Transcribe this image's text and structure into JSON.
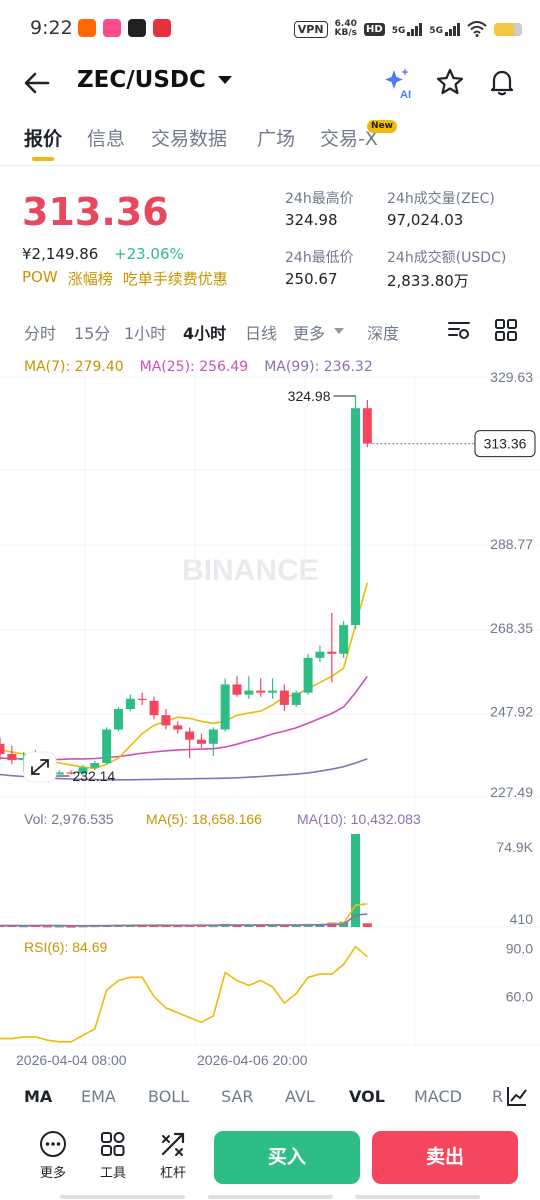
{
  "status": {
    "time": "9:22",
    "vpn": "VPN",
    "speed_value": "6.40",
    "speed_unit": "KB/s",
    "hd_label": "HD",
    "net1": "5G",
    "net2": "5G"
  },
  "header": {
    "title": "ZEC/USDC",
    "ai_label": "AI"
  },
  "tabs": [
    {
      "label": "报价"
    },
    {
      "label": "信息"
    },
    {
      "label": "交易数据"
    },
    {
      "label": "广场"
    },
    {
      "label": "交易-X"
    }
  ],
  "tab_badge": "New",
  "price": {
    "last": "313.36",
    "cny": "¥2,149.86",
    "change": "+23.06%",
    "tags": [
      "POW",
      "涨幅榜",
      "吃单手续费优惠"
    ]
  },
  "stats": {
    "high_label": "24h最高价",
    "high_value": "324.98",
    "low_label": "24h最低价",
    "low_value": "250.67",
    "vol_label": "24h成交量(ZEC)",
    "vol_value": "97,024.03",
    "amount_label": "24h成交额(USDC)",
    "amount_value": "2,833.80万"
  },
  "intervals": [
    "分时",
    "15分",
    "1小时",
    "4小时",
    "日线",
    "更多",
    "深度"
  ],
  "ma_legend": {
    "ma7": "MA(7): 279.40",
    "ma25": "MA(25): 256.49",
    "ma99": "MA(99): 236.32"
  },
  "colors": {
    "up": "#2ebd85",
    "down": "#f6465d",
    "ma7": "#f0b90b",
    "ma25": "#d04fba",
    "ma99": "#8b6fb8",
    "accent": "#f0b90b"
  },
  "watermark": "BINANCE",
  "chart_data": {
    "type": "candlestick",
    "price_axis_ticks": [
      "329.63",
      "288.77",
      "268.35",
      "247.92",
      "227.49"
    ],
    "ylim": [
      227.49,
      329.63
    ],
    "last_price_label": "313.36",
    "high_marker": "324.98",
    "low_marker": "232.14",
    "x_labels": [
      "2026-04-04 08:00",
      "2026-04-06 20:00"
    ],
    "candles": [
      {
        "o": 240.0,
        "h": 241.5,
        "l": 236.0,
        "c": 237.5
      },
      {
        "o": 237.5,
        "h": 239.5,
        "l": 235.0,
        "c": 236.0
      },
      {
        "o": 236.0,
        "h": 238.0,
        "l": 233.0,
        "c": 236.5
      },
      {
        "o": 236.5,
        "h": 238.5,
        "l": 232.5,
        "c": 233.0
      },
      {
        "o": 233.0,
        "h": 234.0,
        "l": 232.14,
        "c": 232.8
      },
      {
        "o": 232.5,
        "h": 233.5,
        "l": 232.5,
        "c": 233.0
      },
      {
        "o": 233.0,
        "h": 233.5,
        "l": 232.5,
        "c": 232.8
      },
      {
        "o": 232.8,
        "h": 234.8,
        "l": 232.3,
        "c": 234.2
      },
      {
        "o": 234.2,
        "h": 235.8,
        "l": 233.6,
        "c": 235.3
      },
      {
        "o": 235.3,
        "h": 244.0,
        "l": 235.0,
        "c": 243.5
      },
      {
        "o": 243.5,
        "h": 249.0,
        "l": 243.0,
        "c": 248.5
      },
      {
        "o": 248.5,
        "h": 252.0,
        "l": 248.0,
        "c": 251.0
      },
      {
        "o": 251.0,
        "h": 252.5,
        "l": 249.5,
        "c": 250.8
      },
      {
        "o": 250.5,
        "h": 251.5,
        "l": 246.0,
        "c": 247.0
      },
      {
        "o": 247.0,
        "h": 248.5,
        "l": 243.5,
        "c": 244.5
      },
      {
        "o": 244.5,
        "h": 245.5,
        "l": 242.5,
        "c": 243.5
      },
      {
        "o": 243.0,
        "h": 244.0,
        "l": 236.5,
        "c": 241.0
      },
      {
        "o": 241.0,
        "h": 242.5,
        "l": 239.0,
        "c": 240.0
      },
      {
        "o": 240.0,
        "h": 244.0,
        "l": 237.0,
        "c": 243.5
      },
      {
        "o": 243.5,
        "h": 256.0,
        "l": 243.0,
        "c": 254.5
      },
      {
        "o": 254.5,
        "h": 256.5,
        "l": 251.5,
        "c": 252.0
      },
      {
        "o": 252.0,
        "h": 256.5,
        "l": 251.0,
        "c": 253.0
      },
      {
        "o": 253.0,
        "h": 256.0,
        "l": 251.5,
        "c": 252.5
      },
      {
        "o": 252.5,
        "h": 256.0,
        "l": 251.0,
        "c": 253.0
      },
      {
        "o": 253.0,
        "h": 254.5,
        "l": 248.0,
        "c": 249.5
      },
      {
        "o": 249.5,
        "h": 253.0,
        "l": 249.0,
        "c": 252.5
      },
      {
        "o": 252.5,
        "h": 262.0,
        "l": 252.0,
        "c": 261.0
      },
      {
        "o": 261.0,
        "h": 264.0,
        "l": 260.0,
        "c": 262.5
      },
      {
        "o": 262.5,
        "h": 272.0,
        "l": 255.0,
        "c": 262.0
      },
      {
        "o": 262.0,
        "h": 270.0,
        "l": 261.0,
        "c": 269.0
      },
      {
        "o": 269.0,
        "h": 324.98,
        "l": 268.0,
        "c": 322.0
      },
      {
        "o": 322.0,
        "h": 324.0,
        "l": 312.5,
        "c": 313.36
      }
    ],
    "ma7": [
      238.5,
      238.0,
      237.5,
      236.8,
      236.0,
      235.3,
      234.8,
      234.3,
      234.0,
      235.0,
      236.5,
      239.5,
      242.5,
      244.5,
      245.5,
      246.5,
      246.2,
      245.5,
      245.0,
      245.5,
      247.0,
      247.5,
      248.0,
      249.5,
      251.5,
      252.0,
      253.5,
      255.0,
      256.5,
      258.5,
      269.0,
      279.4
    ],
    "ma25": [
      236.5,
      236.4,
      236.3,
      236.3,
      236.2,
      236.2,
      236.3,
      236.3,
      236.4,
      236.6,
      236.9,
      237.3,
      237.7,
      238.0,
      238.3,
      238.5,
      238.6,
      238.7,
      238.8,
      239.2,
      239.9,
      240.7,
      241.5,
      242.4,
      243.1,
      243.9,
      245.0,
      246.2,
      247.4,
      249.0,
      252.5,
      256.49
    ],
    "ma99": [
      232.5,
      232.2,
      232.0,
      231.8,
      231.6,
      231.5,
      231.4,
      231.3,
      231.25,
      231.2,
      231.2,
      231.2,
      231.25,
      231.3,
      231.35,
      231.4,
      231.45,
      231.5,
      231.55,
      231.6,
      231.7,
      231.85,
      232.0,
      232.2,
      232.4,
      232.6,
      232.9,
      233.3,
      233.8,
      234.4,
      235.3,
      236.32
    ],
    "volume": {
      "legend_vol": "Vol: 2,976.535",
      "legend_ma5": "MA(5): 18,658.166",
      "legend_ma10": "MA(10): 10,432.083",
      "axis_ticks": [
        "74.9K",
        "410"
      ],
      "ylim": [
        0,
        74900
      ],
      "values": [
        1500,
        1200,
        1000,
        1300,
        900,
        800,
        700,
        900,
        1100,
        1600,
        2000,
        1800,
        1200,
        1400,
        1300,
        1100,
        1500,
        1200,
        1100,
        2500,
        1800,
        1500,
        1400,
        1600,
        1500,
        1900,
        2500,
        2200,
        3500,
        4200,
        74900,
        2976.535
      ],
      "ma5": [
        1200,
        1150,
        1100,
        1150,
        1180,
        1040,
        940,
        920,
        880,
        1020,
        1260,
        1480,
        1540,
        1600,
        1540,
        1360,
        1300,
        1300,
        1240,
        1480,
        1620,
        1620,
        1660,
        1760,
        1560,
        1580,
        1780,
        1940,
        2320,
        2860,
        17460,
        18658.166
      ],
      "ma10": [
        1100,
        1100,
        1080,
        1090,
        1100,
        1100,
        1080,
        1060,
        1040,
        1060,
        1100,
        1160,
        1190,
        1230,
        1280,
        1300,
        1380,
        1410,
        1410,
        1500,
        1520,
        1490,
        1500,
        1520,
        1560,
        1600,
        1700,
        1770,
        1900,
        2160,
        9500,
        10432.083
      ]
    },
    "rsi": {
      "legend": "RSI(6): 84.69",
      "axis_ticks": [
        "90.0",
        "60.0"
      ],
      "ylim": [
        30,
        97
      ],
      "values": [
        34,
        34,
        35,
        35,
        33,
        32,
        32,
        36,
        40,
        64,
        70,
        72,
        72,
        60,
        53,
        50,
        47,
        44,
        48,
        75,
        70,
        67,
        70,
        66,
        56,
        62,
        72,
        74,
        74,
        80,
        91,
        84.69
      ]
    }
  },
  "indicator_tabs": [
    "MA",
    "EMA",
    "BOLL",
    "SAR",
    "AVL",
    "VOL",
    "MACD",
    "R"
  ],
  "bottom": {
    "more": "更多",
    "tools": "工具",
    "leverage": "杠杆",
    "buy": "买入",
    "sell": "卖出"
  }
}
